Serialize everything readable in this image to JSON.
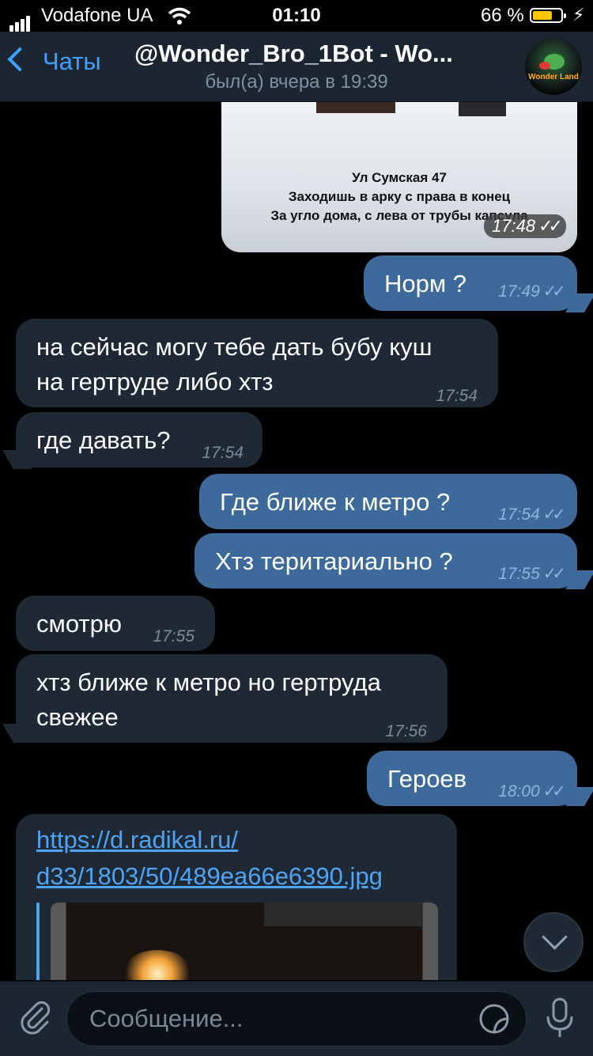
{
  "status_bar": {
    "carrier": "Vodafone UA",
    "time": "01:10",
    "battery_percent": "66 %"
  },
  "header": {
    "back_label": "Чаты",
    "title": "@Wonder_Bro_1Bot - Wo...",
    "subtitle": "был(а) вчера в 19:39",
    "avatar_text": "Wonder Land"
  },
  "image_message": {
    "caption_line1": "Ул Сумская 47",
    "caption_line2": "Заходишь в арку с права в конец",
    "caption_line3": "За угло дома, с лева от трубы капсула",
    "time": "17:48"
  },
  "messages": [
    {
      "direction": "out",
      "text": "Норм ?",
      "time": "17:49"
    },
    {
      "direction": "in",
      "text": "на сейчас могу тебе дать бубу куш",
      "text2": "на гертруде либо хтз",
      "time": "17:54"
    },
    {
      "direction": "in",
      "text": "где давать?",
      "time": "17:54"
    },
    {
      "direction": "out",
      "text": "Где ближе к метро ?",
      "time": "17:54"
    },
    {
      "direction": "out",
      "text": "Хтз теритариально ?",
      "time": "17:55"
    },
    {
      "direction": "in",
      "text": "смотрю",
      "time": "17:55"
    },
    {
      "direction": "in",
      "text": "хтз ближе к метро но гертруда",
      "text2": "свежее",
      "time": "17:56"
    },
    {
      "direction": "out",
      "text": "Героев",
      "time": "18:00"
    }
  ],
  "link_message": {
    "line1": "https://d.radikal.ru/",
    "line2": "d33/1803/50/489ea66e6390.jpg"
  },
  "input": {
    "placeholder": "Сообщение..."
  },
  "icons": [
    "signal-icon",
    "wifi-icon",
    "battery-icon",
    "charging-icon",
    "back-chevron-icon",
    "read-ticks-icon",
    "scroll-down-icon",
    "attach-icon",
    "sticker-icon",
    "mic-icon"
  ],
  "colors": {
    "accent": "#3fa0ff",
    "outgoing_bubble": "#3d6a9b",
    "incoming_bubble": "#1f2936",
    "header_bg": "#1c2633",
    "battery_fill": "#ffc500"
  }
}
